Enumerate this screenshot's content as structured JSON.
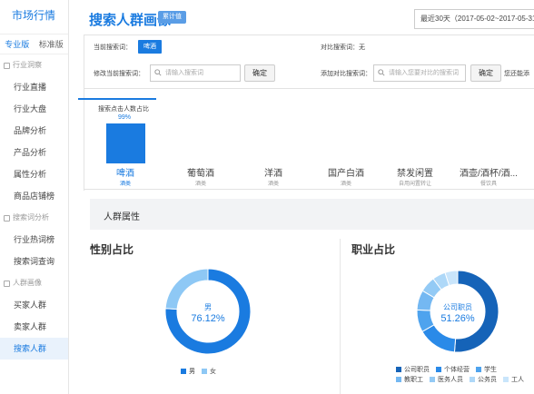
{
  "sidebar": {
    "brand": "市场行情",
    "tabs": [
      {
        "label": "专业版",
        "active": true
      },
      {
        "label": "标准版",
        "active": false
      }
    ],
    "groups": [
      {
        "label": "行业洞察",
        "items": [
          "行业直播",
          "行业大盘",
          "品牌分析",
          "产品分析",
          "属性分析",
          "商品店铺榜"
        ]
      },
      {
        "label": "搜索词分析",
        "items": [
          "行业热词榜",
          "搜索词查询"
        ]
      },
      {
        "label": "人群画像",
        "items": [
          "买家人群",
          "卖家人群",
          "搜索人群"
        ]
      }
    ],
    "active_item": "搜索人群"
  },
  "header": {
    "title": "搜索人群画像",
    "badge": "累计值",
    "date_range": "最近30天（2017-05-02~2017-05-31）"
  },
  "search": {
    "current_label": "当前搜索词：",
    "current_keyword": "啤酒",
    "compare_label": "对比搜索词：无",
    "modify_label": "修改当前搜索词：",
    "modify_placeholder": "请输入搜索词",
    "confirm": "确定",
    "add_compare_label": "添加对比搜索词：",
    "add_compare_placeholder": "请输入您要对比的搜索词",
    "confirm2": "确定",
    "hint": "您还能添"
  },
  "keywords": [
    {
      "name": "啤酒",
      "category": "酒类",
      "active": true
    },
    {
      "name": "葡萄酒",
      "category": "酒类"
    },
    {
      "name": "洋酒",
      "category": "酒类"
    },
    {
      "name": "国产白酒",
      "category": "酒类"
    },
    {
      "name": "禁发闲置",
      "category": "自用闲置转让"
    },
    {
      "name": "酒壶/酒杯/酒...",
      "category": "餐饮具"
    }
  ],
  "chart_data": [
    {
      "type": "bar",
      "title": "搜索点击人数占比",
      "categories": [
        "啤酒"
      ],
      "values": [
        99
      ],
      "value_labels": [
        "99%"
      ],
      "color": "#1a7be0"
    },
    {
      "type": "pie",
      "title": "性别占比",
      "labels": [
        "男",
        "女"
      ],
      "values": [
        76.12,
        23.88
      ],
      "colors": [
        "#1a7be0",
        "#8ec8f5"
      ],
      "center_label": "男",
      "center_value": "76.12%",
      "legend": "bottom"
    },
    {
      "type": "pie",
      "title": "职业占比",
      "labels": [
        "公司职员",
        "个体经营/服务人员",
        "学生",
        "教职工",
        "医务人员",
        "公务员",
        "工人"
      ],
      "legend_labels": [
        "公司职员",
        "个体经营",
        "学生",
        "教职工",
        "医务人员",
        "公务员",
        "工人"
      ],
      "values": [
        51.26,
        15.5,
        8.8,
        7.9,
        6.3,
        5.2,
        5.04
      ],
      "colors": [
        "#1563b8",
        "#2a8ae8",
        "#4ea3ee",
        "#74b8f2",
        "#93caf5",
        "#aed8f8",
        "#c9e5fb"
      ],
      "center_label": "公司职员",
      "center_value": "51.26%",
      "legend": "bottom"
    }
  ],
  "section": {
    "title": "人群属性",
    "gender_title": "性别占比",
    "occupation_title": "职业占比"
  },
  "colors": {
    "accent": "#1a7be0"
  }
}
